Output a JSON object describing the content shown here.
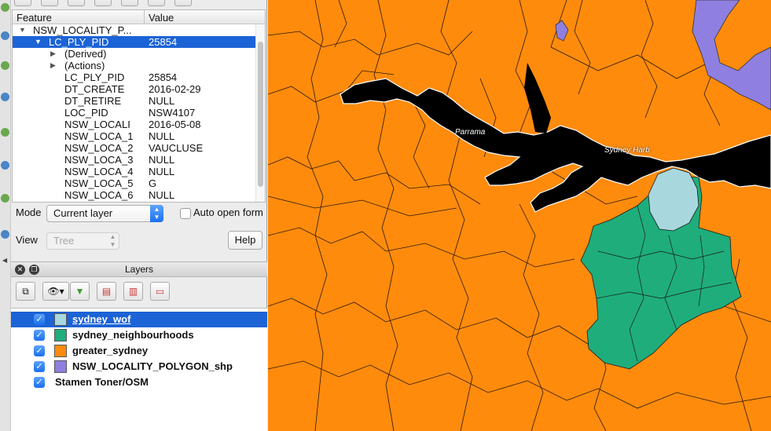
{
  "feature_tree": {
    "header": {
      "feature": "Feature",
      "value": "Value"
    },
    "layer_row": {
      "label": "NSW_LOCALITY_P..."
    },
    "selected_feature": {
      "key": "LC_PLY_PID",
      "value": "25854"
    },
    "groups": [
      "(Derived)",
      "(Actions)"
    ],
    "attributes": [
      {
        "key": "LC_PLY_PID",
        "value": "25854"
      },
      {
        "key": "DT_CREATE",
        "value": "2016-02-29"
      },
      {
        "key": "DT_RETIRE",
        "value": "NULL"
      },
      {
        "key": "LOC_PID",
        "value": "NSW4107"
      },
      {
        "key": "NSW_LOCALI",
        "value": "2016-05-08"
      },
      {
        "key": "NSW_LOCA_1",
        "value": "NULL"
      },
      {
        "key": "NSW_LOCA_2",
        "value": "VAUCLUSE"
      },
      {
        "key": "NSW_LOCA_3",
        "value": "NULL"
      },
      {
        "key": "NSW_LOCA_4",
        "value": "NULL"
      },
      {
        "key": "NSW_LOCA_5",
        "value": "G"
      },
      {
        "key": "NSW_LOCA_6",
        "value": "NULL"
      }
    ]
  },
  "controls": {
    "mode_label": "Mode",
    "mode_value": "Current layer",
    "auto_open_label": "Auto open form",
    "view_label": "View",
    "view_value": "Tree",
    "help_label": "Help"
  },
  "layers_panel": {
    "title": "Layers",
    "layers": [
      {
        "name": "sydney_wof",
        "color": "#a8d8de",
        "checked": true,
        "selected": true
      },
      {
        "name": "sydney_neighbourhoods",
        "color": "#1fad7c",
        "checked": true
      },
      {
        "name": "greater_sydney",
        "color": "#ff8b0d",
        "checked": true
      },
      {
        "name": "NSW_LOCALITY_POLYGON_shp",
        "color": "#8f7fe0",
        "checked": true
      },
      {
        "name": "Stamen Toner/OSM",
        "checked": true
      }
    ]
  },
  "map": {
    "labels": {
      "parramatta": "Parrama",
      "sydney_harbour": "Sydney Harb"
    },
    "colors": {
      "land": "#ff8b0d",
      "water": "#000000",
      "neighbourhoods": "#1fad7c",
      "wof": "#a8d8de",
      "locality": "#8f7fe0"
    }
  }
}
